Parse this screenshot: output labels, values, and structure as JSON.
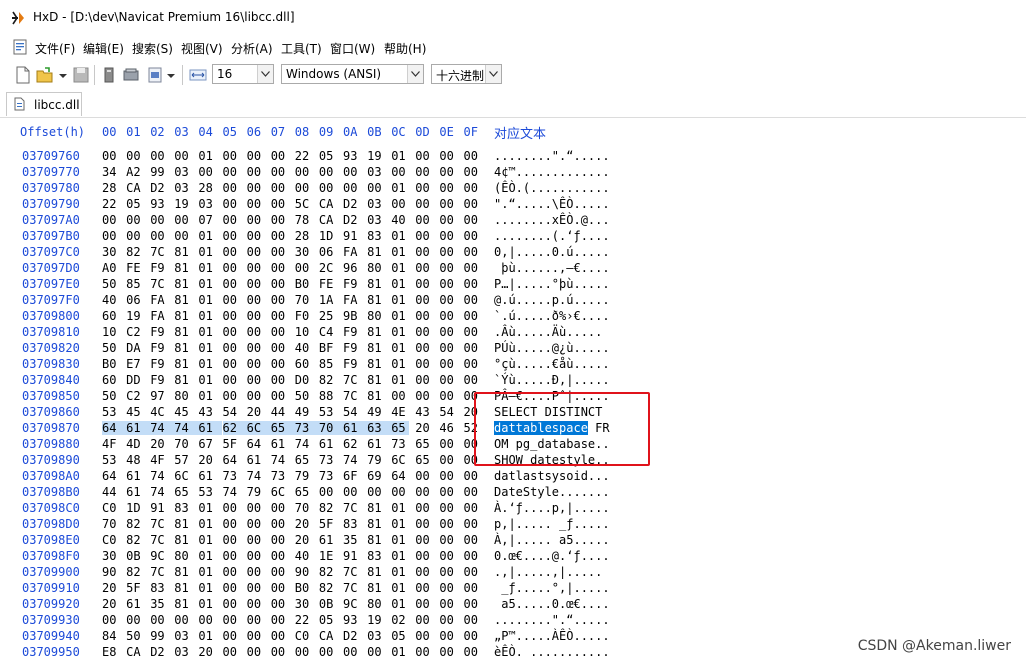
{
  "window": {
    "title": "HxD - [D:\\dev\\Navicat Premium 16\\libcc.dll]"
  },
  "menu": [
    "文件(F)",
    "编辑(E)",
    "搜索(S)",
    "视图(V)",
    "分析(A)",
    "工具(T)",
    "窗口(W)",
    "帮助(H)"
  ],
  "toolbar": {
    "bytes_per_row": "16",
    "encoding": "Windows (ANSI)",
    "display_mode": "十六进制"
  },
  "tab": {
    "label": "libcc.dll"
  },
  "hex": {
    "offset_header": "Offset(h)",
    "columns": [
      "00",
      "01",
      "02",
      "03",
      "04",
      "05",
      "06",
      "07",
      "08",
      "09",
      "0A",
      "0B",
      "0C",
      "0D",
      "0E",
      "0F"
    ],
    "text_header": "对应文本",
    "rows": [
      {
        "offset": "03709760",
        "bytes": [
          "00",
          "00",
          "00",
          "00",
          "01",
          "00",
          "00",
          "00",
          "22",
          "05",
          "93",
          "19",
          "01",
          "00",
          "00",
          "00"
        ],
        "text": "........\".“....."
      },
      {
        "offset": "03709770",
        "bytes": [
          "34",
          "A2",
          "99",
          "03",
          "00",
          "00",
          "00",
          "00",
          "00",
          "00",
          "00",
          "03",
          "00",
          "00",
          "00",
          "00"
        ],
        "text": "4¢™............."
      },
      {
        "offset": "03709780",
        "bytes": [
          "28",
          "CA",
          "D2",
          "03",
          "28",
          "00",
          "00",
          "00",
          "00",
          "00",
          "00",
          "00",
          "01",
          "00",
          "00",
          "00"
        ],
        "text": "(ÊÒ.(..........."
      },
      {
        "offset": "03709790",
        "bytes": [
          "22",
          "05",
          "93",
          "19",
          "03",
          "00",
          "00",
          "00",
          "5C",
          "CA",
          "D2",
          "03",
          "00",
          "00",
          "00",
          "00"
        ],
        "text": "\".“.....\\ÊÒ....."
      },
      {
        "offset": "037097A0",
        "bytes": [
          "00",
          "00",
          "00",
          "00",
          "07",
          "00",
          "00",
          "00",
          "78",
          "CA",
          "D2",
          "03",
          "40",
          "00",
          "00",
          "00"
        ],
        "text": "........xÊÒ.@..."
      },
      {
        "offset": "037097B0",
        "bytes": [
          "00",
          "00",
          "00",
          "00",
          "01",
          "00",
          "00",
          "00",
          "28",
          "1D",
          "91",
          "83",
          "01",
          "00",
          "00",
          "00"
        ],
        "text": "........(.‘ƒ...."
      },
      {
        "offset": "037097C0",
        "bytes": [
          "30",
          "82",
          "7C",
          "81",
          "01",
          "00",
          "00",
          "00",
          "30",
          "06",
          "FA",
          "81",
          "01",
          "00",
          "00",
          "00"
        ],
        "text": "0‚|.....0.ú....."
      },
      {
        "offset": "037097D0",
        "bytes": [
          "A0",
          "FE",
          "F9",
          "81",
          "01",
          "00",
          "00",
          "00",
          "00",
          "2C",
          "96",
          "80",
          "01",
          "00",
          "00",
          "00"
        ],
        "text": " þù......,–€...."
      },
      {
        "offset": "037097E0",
        "bytes": [
          "50",
          "85",
          "7C",
          "81",
          "01",
          "00",
          "00",
          "00",
          "B0",
          "FE",
          "F9",
          "81",
          "01",
          "00",
          "00",
          "00"
        ],
        "text": "P…|.....°þù....."
      },
      {
        "offset": "037097F0",
        "bytes": [
          "40",
          "06",
          "FA",
          "81",
          "01",
          "00",
          "00",
          "00",
          "70",
          "1A",
          "FA",
          "81",
          "01",
          "00",
          "00",
          "00"
        ],
        "text": "@.ú.....p.ú....."
      },
      {
        "offset": "03709800",
        "bytes": [
          "60",
          "19",
          "FA",
          "81",
          "01",
          "00",
          "00",
          "00",
          "F0",
          "25",
          "9B",
          "80",
          "01",
          "00",
          "00",
          "00"
        ],
        "text": "`.ú.....ð%›€...."
      },
      {
        "offset": "03709810",
        "bytes": [
          "10",
          "C2",
          "F9",
          "81",
          "01",
          "00",
          "00",
          "00",
          "10",
          "C4",
          "F9",
          "81",
          "01",
          "00",
          "00",
          "00"
        ],
        "text": ".Âù.....Äù....."
      },
      {
        "offset": "03709820",
        "bytes": [
          "50",
          "DA",
          "F9",
          "81",
          "01",
          "00",
          "00",
          "00",
          "40",
          "BF",
          "F9",
          "81",
          "01",
          "00",
          "00",
          "00"
        ],
        "text": "PÚù.....@¿ù....."
      },
      {
        "offset": "03709830",
        "bytes": [
          "B0",
          "E7",
          "F9",
          "81",
          "01",
          "00",
          "00",
          "00",
          "60",
          "85",
          "F9",
          "81",
          "01",
          "00",
          "00",
          "00"
        ],
        "text": "°çù.....€åù....."
      },
      {
        "offset": "03709840",
        "bytes": [
          "60",
          "DD",
          "F9",
          "81",
          "01",
          "00",
          "00",
          "00",
          "D0",
          "82",
          "7C",
          "81",
          "01",
          "00",
          "00",
          "00"
        ],
        "text": "`Ýù.....Ð‚|....."
      },
      {
        "offset": "03709850",
        "bytes": [
          "50",
          "C2",
          "97",
          "80",
          "01",
          "00",
          "00",
          "00",
          "50",
          "88",
          "7C",
          "81",
          "00",
          "00",
          "00",
          "00"
        ],
        "text": "PÂ—€....Pˆ|....."
      },
      {
        "offset": "03709860",
        "bytes": [
          "53",
          "45",
          "4C",
          "45",
          "43",
          "54",
          "20",
          "44",
          "49",
          "53",
          "54",
          "49",
          "4E",
          "43",
          "54",
          "20"
        ],
        "text": "SELECT DISTINCT "
      },
      {
        "offset": "03709870",
        "bytes": [
          "64",
          "61",
          "74",
          "74",
          "61",
          "62",
          "6C",
          "65",
          "73",
          "70",
          "61",
          "63",
          "65",
          "20",
          "46",
          "52"
        ],
        "text": "dattablespace FR"
      },
      {
        "offset": "03709880",
        "bytes": [
          "4F",
          "4D",
          "20",
          "70",
          "67",
          "5F",
          "64",
          "61",
          "74",
          "61",
          "62",
          "61",
          "73",
          "65",
          "00",
          "00"
        ],
        "text": "OM pg_database.."
      },
      {
        "offset": "03709890",
        "bytes": [
          "53",
          "48",
          "4F",
          "57",
          "20",
          "64",
          "61",
          "74",
          "65",
          "73",
          "74",
          "79",
          "6C",
          "65",
          "00",
          "00"
        ],
        "text": "SHOW datestyle.."
      },
      {
        "offset": "037098A0",
        "bytes": [
          "64",
          "61",
          "74",
          "6C",
          "61",
          "73",
          "74",
          "73",
          "79",
          "73",
          "6F",
          "69",
          "64",
          "00",
          "00",
          "00"
        ],
        "text": "datlastsysoid..."
      },
      {
        "offset": "037098B0",
        "bytes": [
          "44",
          "61",
          "74",
          "65",
          "53",
          "74",
          "79",
          "6C",
          "65",
          "00",
          "00",
          "00",
          "00",
          "00",
          "00",
          "00"
        ],
        "text": "DateStyle......."
      },
      {
        "offset": "037098C0",
        "bytes": [
          "C0",
          "1D",
          "91",
          "83",
          "01",
          "00",
          "00",
          "00",
          "70",
          "82",
          "7C",
          "81",
          "01",
          "00",
          "00",
          "00"
        ],
        "text": "À.‘ƒ....p‚|....."
      },
      {
        "offset": "037098D0",
        "bytes": [
          "70",
          "82",
          "7C",
          "81",
          "01",
          "00",
          "00",
          "00",
          "20",
          "5F",
          "83",
          "81",
          "01",
          "00",
          "00",
          "00"
        ],
        "text": "p‚|..... _ƒ....."
      },
      {
        "offset": "037098E0",
        "bytes": [
          "C0",
          "82",
          "7C",
          "81",
          "01",
          "00",
          "00",
          "00",
          "20",
          "61",
          "35",
          "81",
          "01",
          "00",
          "00",
          "00"
        ],
        "text": "À‚|..... a5....."
      },
      {
        "offset": "037098F0",
        "bytes": [
          "30",
          "0B",
          "9C",
          "80",
          "01",
          "00",
          "00",
          "00",
          "40",
          "1E",
          "91",
          "83",
          "01",
          "00",
          "00",
          "00"
        ],
        "text": "0.œ€....@.‘ƒ...."
      },
      {
        "offset": "03709900",
        "bytes": [
          "90",
          "82",
          "7C",
          "81",
          "01",
          "00",
          "00",
          "00",
          "90",
          "82",
          "7C",
          "81",
          "01",
          "00",
          "00",
          "00"
        ],
        "text": ".‚|.....‚|....."
      },
      {
        "offset": "03709910",
        "bytes": [
          "20",
          "5F",
          "83",
          "81",
          "01",
          "00",
          "00",
          "00",
          "B0",
          "82",
          "7C",
          "81",
          "01",
          "00",
          "00",
          "00"
        ],
        "text": " _ƒ.....°‚|....."
      },
      {
        "offset": "03709920",
        "bytes": [
          "20",
          "61",
          "35",
          "81",
          "01",
          "00",
          "00",
          "00",
          "30",
          "0B",
          "9C",
          "80",
          "01",
          "00",
          "00",
          "00"
        ],
        "text": " a5.....0.œ€...."
      },
      {
        "offset": "03709930",
        "bytes": [
          "00",
          "00",
          "00",
          "00",
          "00",
          "00",
          "00",
          "00",
          "22",
          "05",
          "93",
          "19",
          "02",
          "00",
          "00",
          "00"
        ],
        "text": "........\".“....."
      },
      {
        "offset": "03709940",
        "bytes": [
          "84",
          "50",
          "99",
          "03",
          "01",
          "00",
          "00",
          "00",
          "C0",
          "CA",
          "D2",
          "03",
          "05",
          "00",
          "00",
          "00"
        ],
        "text": "„P™.....ÀÊÒ....."
      },
      {
        "offset": "03709950",
        "bytes": [
          "E8",
          "CA",
          "D2",
          "03",
          "20",
          "00",
          "00",
          "00",
          "00",
          "00",
          "00",
          "00",
          "01",
          "00",
          "00",
          "00"
        ],
        "text": "èÊÒ. ..........."
      }
    ]
  },
  "watermark": "CSDN @Akeman.liwer",
  "colors": {
    "offset_blue": "#1c4ad8",
    "highlight": "#c3ddf7",
    "selection": "#0078d7",
    "annotation_red": "#e0131b"
  }
}
